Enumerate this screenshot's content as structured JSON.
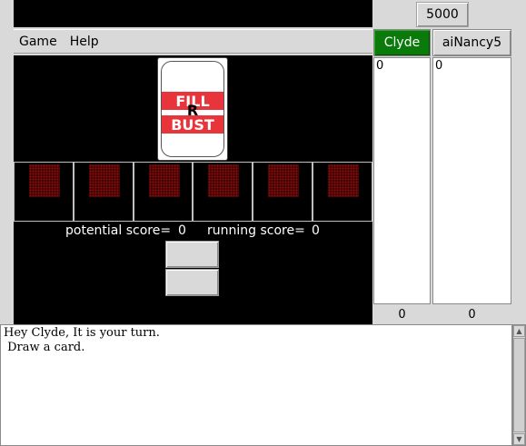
{
  "target_score": "5000",
  "menu": {
    "items": [
      "Game",
      "Help"
    ]
  },
  "players": [
    {
      "name": "Clyde",
      "list": [
        "0"
      ],
      "total": "0",
      "active": true,
      "color": "#0a7a0a"
    },
    {
      "name": "aiNancy5",
      "list": [
        "0"
      ],
      "total": "0",
      "active": false
    }
  ],
  "deck": {
    "top_band": "FILL",
    "letter": "R",
    "bottom_band": "BUST",
    "band_color": "#e8343b"
  },
  "slots": {
    "count": 6,
    "card_back_color": "#3a0000"
  },
  "scores": {
    "potential_label": "potential score=",
    "potential_value": "0",
    "running_label": "running score=",
    "running_value": "0"
  },
  "action_buttons": [
    "",
    ""
  ],
  "messages": {
    "line1": "Hey Clyde, It is your turn.",
    "line2": " Draw a card."
  }
}
